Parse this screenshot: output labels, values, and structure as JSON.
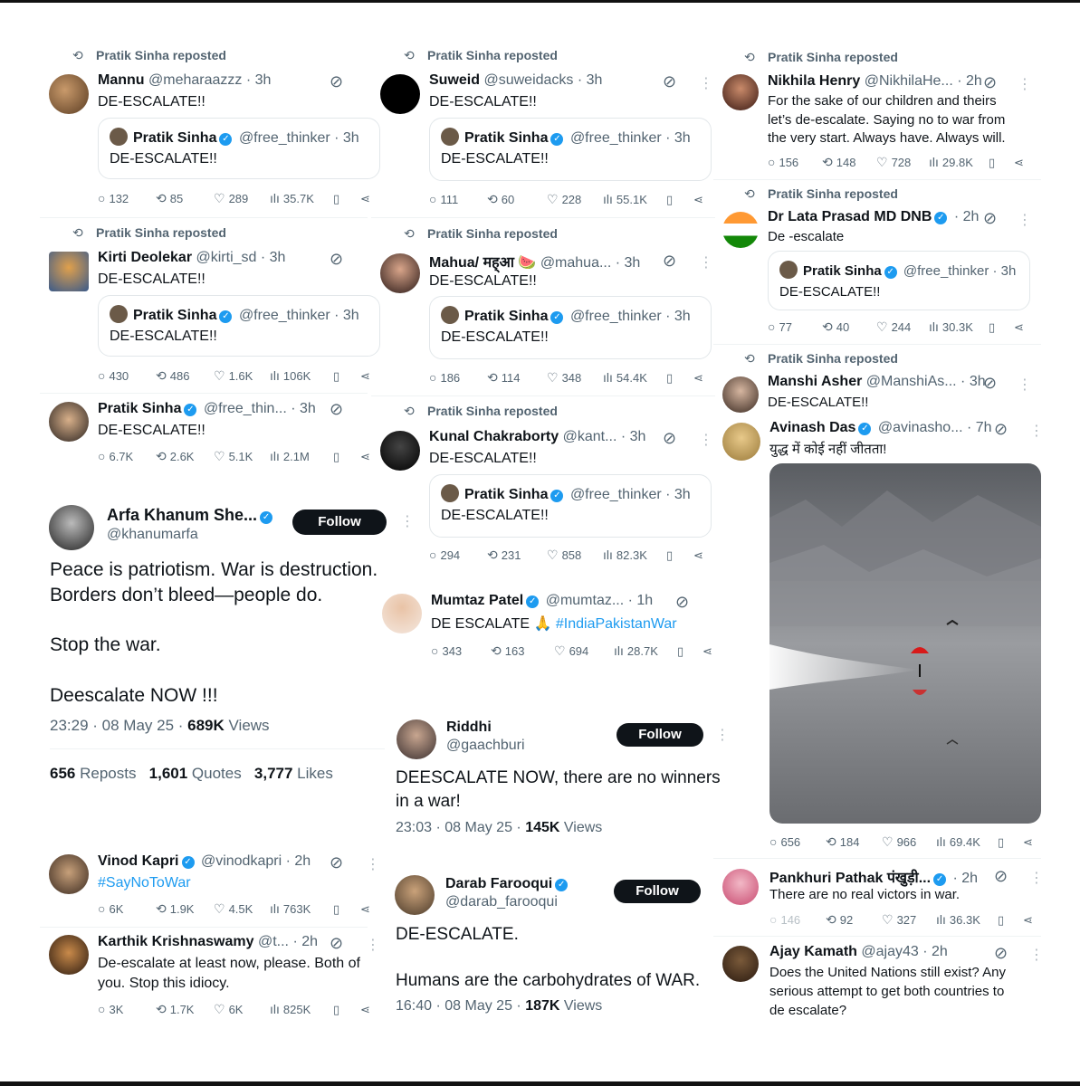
{
  "col1": {
    "t1": {
      "repost": "Pratik Sinha reposted",
      "name": "Mannu",
      "handle": "@meharaazzz · 3h",
      "text": "DE-ESCALATE!!",
      "quote": {
        "name": "Pratik Sinha",
        "handle": "@free_thinker · 3h",
        "text": "DE-ESCALATE!!"
      },
      "replies": "132",
      "reposts": "85",
      "likes": "289",
      "views": "35.7K"
    },
    "t2": {
      "repost": "Pratik Sinha reposted",
      "name": "Kirti Deolekar",
      "handle": "@kirti_sd · 3h",
      "text": "DE-ESCALATE!!",
      "quote": {
        "name": "Pratik Sinha",
        "handle": "@free_thinker · 3h",
        "text": "DE-ESCALATE!!"
      },
      "replies": "430",
      "reposts": "486",
      "likes": "1.6K",
      "views": "106K"
    },
    "t3": {
      "name": "Pratik Sinha",
      "handle": "@free_thin... · 3h",
      "text": "DE-ESCALATE!!",
      "replies": "6.7K",
      "reposts": "2.6K",
      "likes": "5.1K",
      "views": "2.1M"
    },
    "arfa": {
      "name": "Arfa Khanum She...",
      "handle": "@khanumarfa",
      "follow": "Follow",
      "line1": "Peace is patriotism. War is destruction.",
      "line2": "Borders don’t bleed—people do.",
      "line3": "Stop the war.",
      "line4": "Deescalate NOW !!!",
      "date": "23:29 · 08 May 25 · ",
      "views_num": "689K",
      "views_label": " Views",
      "reposts_num": "656",
      "reposts_label": " Reposts",
      "quotes_num": "1,601",
      "quotes_label": " Quotes",
      "likes_num": "3,777",
      "likes_label": " Likes"
    },
    "t4": {
      "name": "Vinod Kapri",
      "handle": "@vinodkapri · 2h",
      "text": "#SayNoToWar",
      "replies": "6K",
      "reposts": "1.9K",
      "likes": "4.5K",
      "views": "763K"
    },
    "t5": {
      "name": "Karthik Krishnaswamy",
      "handle": "@t... · 2h",
      "line1": "De-escalate at least now, please. Both of",
      "line2": "you. Stop this idiocy.",
      "replies": "3K",
      "reposts": "1.7K",
      "likes": "6K",
      "views": "825K"
    }
  },
  "col2": {
    "t1": {
      "repost": "Pratik Sinha reposted",
      "name": "Suweid",
      "handle": "@suweidacks · 3h",
      "text": "DE-ESCALATE!!",
      "quote": {
        "name": "Pratik Sinha",
        "handle": "@free_thinker · 3h",
        "text": "DE-ESCALATE!!"
      },
      "replies": "111",
      "reposts": "60",
      "likes": "228",
      "views": "55.1K"
    },
    "t2": {
      "repost": "Pratik Sinha reposted",
      "name": "Mahua/ मह्‌आ 🍉",
      "handle": "@mahua... · 3h",
      "text": "DE-ESCALATE!!",
      "quote": {
        "name": "Pratik Sinha",
        "handle": "@free_thinker · 3h",
        "text": "DE-ESCALATE!!"
      },
      "replies": "186",
      "reposts": "114",
      "likes": "348",
      "views": "54.4K"
    },
    "t3": {
      "repost": "Pratik Sinha reposted",
      "name": "Kunal Chakraborty",
      "handle": "@kant... · 3h",
      "text": "DE-ESCALATE!!",
      "quote": {
        "name": "Pratik Sinha",
        "handle": "@free_thinker · 3h",
        "text": "DE-ESCALATE!!"
      },
      "replies": "294",
      "reposts": "231",
      "likes": "858",
      "views": "82.3K"
    },
    "t4": {
      "name": "Mumtaz Patel",
      "handle": "@mumtaz... · 1h",
      "text": "DE ESCALATE 🙏 ",
      "hashtag": "#IndiaPakistanWar",
      "replies": "343",
      "reposts": "163",
      "likes": "694",
      "views": "28.7K"
    },
    "riddhi": {
      "name": "Riddhi",
      "handle": "@gaachburi",
      "follow": "Follow",
      "line1": "DEESCALATE NOW, there are no winners",
      "line2": "in a war!",
      "date": "23:03 · 08 May 25 · ",
      "views_num": "145K",
      "views_label": " Views"
    },
    "darab": {
      "name": "Darab Farooqui",
      "handle": "@darab_farooqui",
      "follow": "Follow",
      "line1": "DE-ESCALATE.",
      "line2": "Humans are the carbohydrates of WAR.",
      "date": "16:40 · 08 May 25 · ",
      "views_num": "187K",
      "views_label": " Views"
    }
  },
  "col3": {
    "t1": {
      "repost": "Pratik Sinha reposted",
      "name": "Nikhila Henry",
      "handle": "@NikhilaHe... · 2h",
      "line1": "For the sake of our children and theirs",
      "line2": "let’s de-escalate. Saying no to war from",
      "line3": "the very start. Always have. Always will.",
      "replies": "156",
      "reposts": "148",
      "likes": "728",
      "views": "29.8K"
    },
    "t2": {
      "repost": "Pratik Sinha reposted",
      "name": "Dr Lata Prasad MD DNB",
      "handle": "· 2h",
      "text": "De -escalate",
      "quote": {
        "name": "Pratik Sinha",
        "handle": "@free_thinker · 3h",
        "text": "DE-ESCALATE!!"
      },
      "replies": "77",
      "reposts": "40",
      "likes": "244",
      "views": "30.3K"
    },
    "t3": {
      "repost": "Pratik Sinha reposted",
      "name": "Manshi Asher",
      "handle": "@ManshiAs... · 3h",
      "text": "DE-ESCALATE!!"
    },
    "t4": {
      "name": "Avinash Das",
      "handle": "@avinasho... · 7h",
      "text": "युद्ध में कोई नहीं जीतता!",
      "replies": "656",
      "reposts": "184",
      "likes": "966",
      "views": "69.4K"
    },
    "t5": {
      "name": "Pankhuri Pathak पंखुड़ी...",
      "handle": "· 2h",
      "text": "There are no real victors in war.",
      "replies": "146",
      "reposts": "92",
      "likes": "327",
      "views": "36.3K"
    },
    "t6": {
      "name": "Ajay Kamath",
      "handle": "@ajay43 · 2h",
      "line1": "Does the United Nations still exist? Any",
      "line2": "serious attempt to get both countries to",
      "line3": "de escalate?"
    }
  },
  "colors": {
    "accent": "#1d9bf0",
    "text": "#0f1419",
    "muted": "#536471"
  }
}
